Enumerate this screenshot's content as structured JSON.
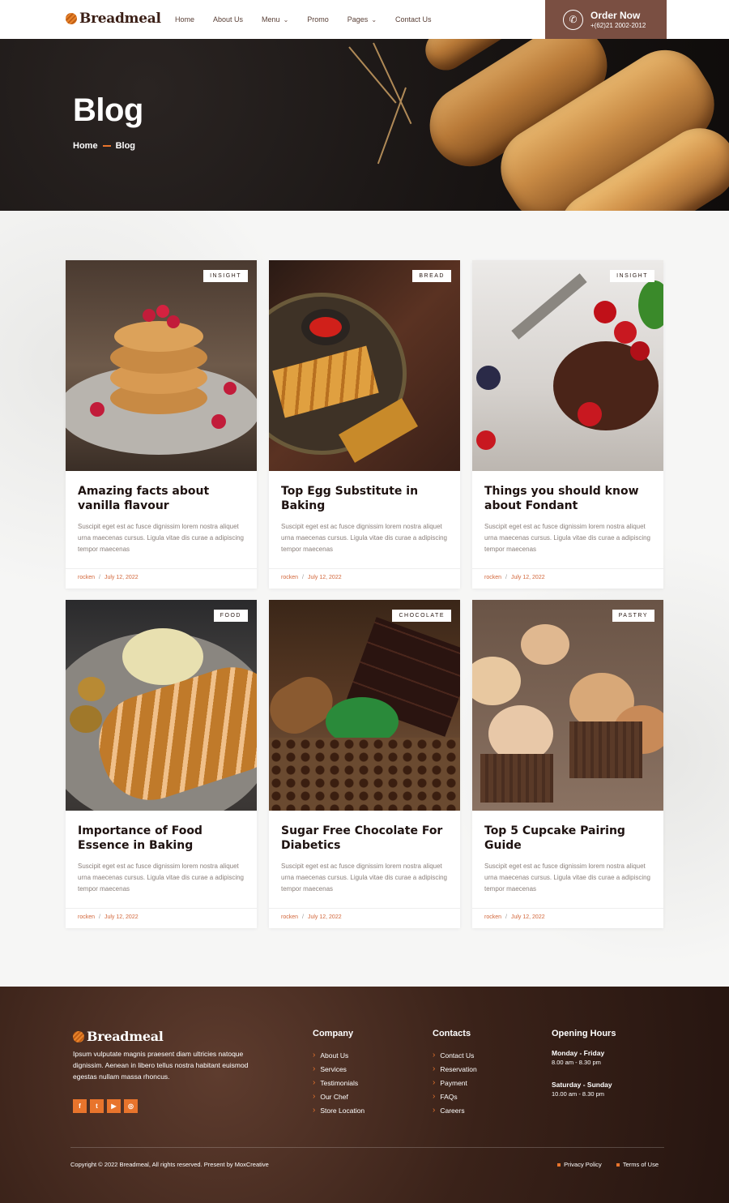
{
  "brand": {
    "name": "Breadmeal"
  },
  "nav": {
    "items": [
      {
        "label": "Home",
        "has_dropdown": false
      },
      {
        "label": "About Us",
        "has_dropdown": false
      },
      {
        "label": "Menu",
        "has_dropdown": true
      },
      {
        "label": "Promo",
        "has_dropdown": false
      },
      {
        "label": "Pages",
        "has_dropdown": true
      },
      {
        "label": "Contact Us",
        "has_dropdown": false
      }
    ]
  },
  "order": {
    "title": "Order Now",
    "phone": "+(62)21 2002-2012",
    "icon": "phone-icon"
  },
  "hero": {
    "title": "Blog",
    "breadcrumb": {
      "home": "Home",
      "current": "Blog"
    }
  },
  "posts": [
    {
      "badge": "INSIGHT",
      "title": "Amazing facts about vanilla flavour",
      "excerpt": "Suscipit eget est ac fusce dignissim lorem nostra aliquet urna maecenas cursus. Ligula vitae dis curae a adipiscing tempor maecenas",
      "author": "rocken",
      "date": "July 12, 2022"
    },
    {
      "badge": "BREAD",
      "title": "Top Egg Substitute in Baking",
      "excerpt": "Suscipit eget est ac fusce dignissim lorem nostra aliquet urna maecenas cursus. Ligula vitae dis curae a adipiscing tempor maecenas",
      "author": "rocken",
      "date": "July 12, 2022"
    },
    {
      "badge": "INSIGHT",
      "title": "Things you should know about Fondant",
      "excerpt": "Suscipit eget est ac fusce dignissim lorem nostra aliquet urna maecenas cursus. Ligula vitae dis curae a adipiscing tempor maecenas",
      "author": "rocken",
      "date": "July 12, 2022"
    },
    {
      "badge": "FOOD",
      "title": "Importance of Food Essence in Baking",
      "excerpt": "Suscipit eget est ac fusce dignissim lorem nostra aliquet urna maecenas cursus. Ligula vitae dis curae a adipiscing tempor maecenas",
      "author": "rocken",
      "date": "July 12, 2022"
    },
    {
      "badge": "CHOCOLATE",
      "title": "Sugar Free Chocolate For Diabetics",
      "excerpt": "Suscipit eget est ac fusce dignissim lorem nostra aliquet urna maecenas cursus. Ligula vitae dis curae a adipiscing tempor maecenas",
      "author": "rocken",
      "date": "July 12, 2022"
    },
    {
      "badge": "PASTRY",
      "title": "Top 5 Cupcake Pairing Guide",
      "excerpt": "Suscipit eget est ac fusce dignissim lorem nostra aliquet urna maecenas cursus. Ligula vitae dis curae a adipiscing tempor maecenas",
      "author": "rocken",
      "date": "July 12, 2022"
    }
  ],
  "footer": {
    "about": "Ipsum vulputate magnis praesent diam ultricies natoque dignissim. Aenean in libero tellus nostra habitant euismod egestas nullam massa rhoncus.",
    "socials": [
      "facebook-icon",
      "twitter-icon",
      "youtube-icon",
      "instagram-icon"
    ],
    "company": {
      "title": "Company",
      "links": [
        "About Us",
        "Services",
        "Testimonials",
        "Our Chef",
        "Store Location"
      ]
    },
    "contacts": {
      "title": "Contacts",
      "links": [
        "Contact Us",
        "Reservation",
        "Payment",
        "FAQs",
        "Careers"
      ]
    },
    "hours": {
      "title": "Opening Hours",
      "weekday_label": "Monday - Friday",
      "weekday_time": "8.00 am - 8.30 pm",
      "weekend_label": "Saturday - Sunday",
      "weekend_time": "10.00 am - 8.30 pm"
    },
    "copyright": "Copyright © 2022 Breadmeal, All rights reserved. Present by MoxCreative",
    "legal": [
      "Privacy Policy",
      "Terms of Use"
    ]
  },
  "colors": {
    "accent": "#e8742c",
    "brown": "#7a4f42",
    "meta": "#d2663a"
  }
}
